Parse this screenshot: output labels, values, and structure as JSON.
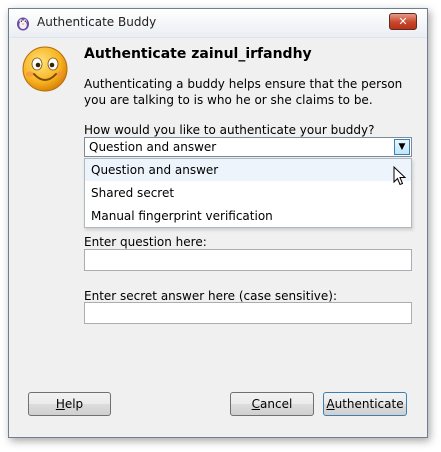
{
  "window": {
    "title": "Authenticate Buddy",
    "close_label": "✕"
  },
  "header": {
    "heading": "Authenticate zainul_irfandhy",
    "description": "Authenticating a buddy helps ensure that the person you are talking to is who he or she claims to be."
  },
  "method": {
    "label": "How would you like to authenticate your buddy?",
    "selected": "Question and answer",
    "options": [
      {
        "label": "Question and answer"
      },
      {
        "label": "Shared secret"
      },
      {
        "label": "Manual fingerprint verification"
      }
    ]
  },
  "question": {
    "label": "Enter question here:",
    "value": ""
  },
  "answer": {
    "label": "Enter secret answer here (case sensitive):",
    "value": ""
  },
  "buttons": {
    "help": {
      "mnemonic": "H",
      "rest": "elp"
    },
    "cancel": {
      "mnemonic": "C",
      "rest": "ancel"
    },
    "authenticate": {
      "mnemonic": "A",
      "rest": "uthenticate"
    }
  },
  "icons": {
    "app": "pidgin-icon",
    "buddy": "smiley-icon",
    "cursor": "mouse-pointer-icon"
  }
}
